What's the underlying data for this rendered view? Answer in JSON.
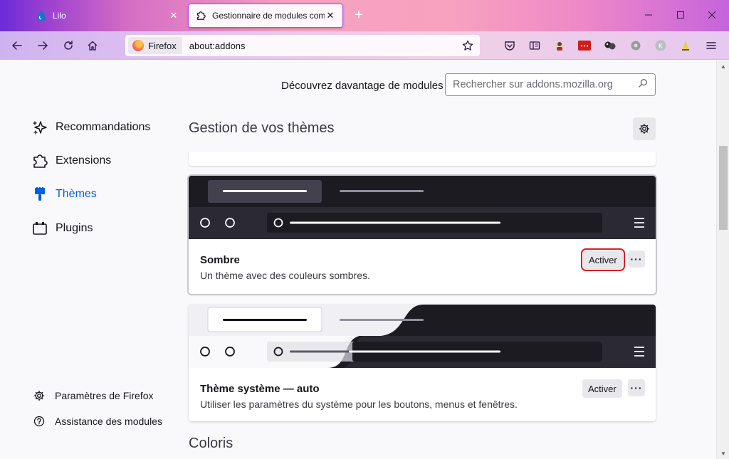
{
  "tabs": [
    {
      "title": "Lilo",
      "active": false
    },
    {
      "title": "Gestionnaire de modules compl",
      "active": true
    }
  ],
  "urlbar": {
    "identity_label": "Firefox",
    "url": "about:addons"
  },
  "discover": {
    "label": "Découvrez davantage de modules",
    "search_placeholder": "Rechercher sur addons.mozilla.org"
  },
  "sidebar": {
    "categories": [
      {
        "label": "Recommandations",
        "icon": "sparkle-icon"
      },
      {
        "label": "Extensions",
        "icon": "puzzle-icon"
      },
      {
        "label": "Thèmes",
        "icon": "brush-icon",
        "selected": true
      },
      {
        "label": "Plugins",
        "icon": "plugin-icon"
      }
    ],
    "footer": [
      {
        "label": "Paramètres de Firefox",
        "icon": "gear-icon"
      },
      {
        "label": "Assistance des modules",
        "icon": "help-icon"
      }
    ]
  },
  "main": {
    "heading": "Gestion de vos thèmes",
    "themes": [
      {
        "name": "Sombre",
        "description": "Un thème avec des couleurs sombres.",
        "action_label": "Activer"
      },
      {
        "name": "Thème système — auto",
        "description": "Utiliser les paramètres du système pour les boutons, menus et fenêtres.",
        "action_label": "Activer"
      }
    ],
    "section_coloris": "Coloris"
  },
  "colors": {
    "accent": "#0061e0",
    "highlight": "#e01b24",
    "dark_preview": "#1c1b22",
    "dark_toolbar": "#2b2a33"
  }
}
